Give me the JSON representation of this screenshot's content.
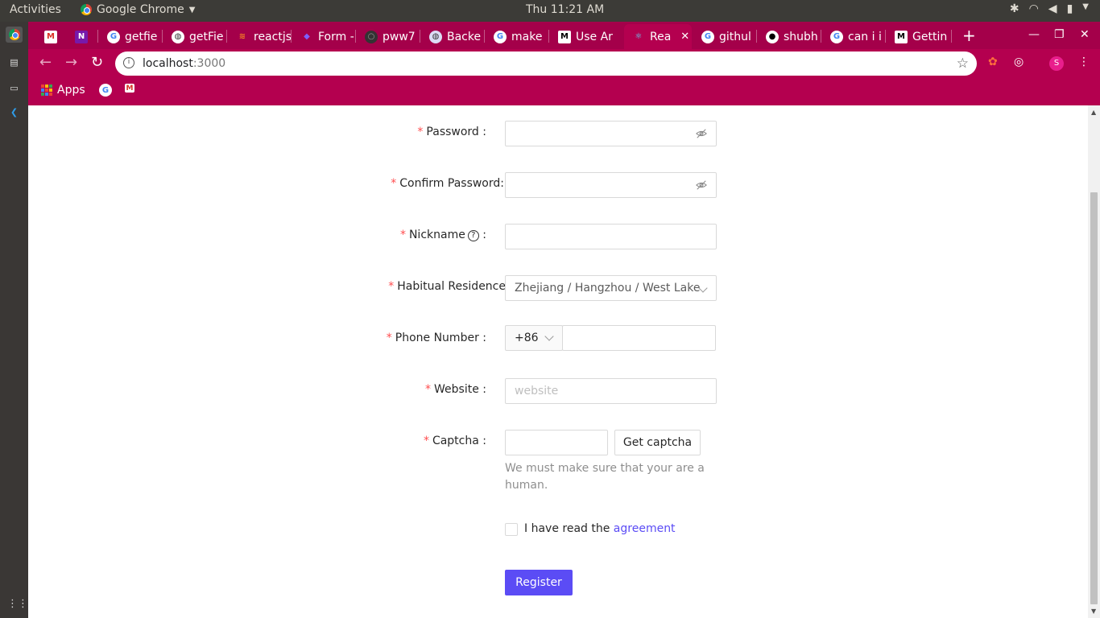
{
  "system_bar": {
    "activities": "Activities",
    "app_name": "Google Chrome",
    "clock": "Thu 11:21 AM"
  },
  "tabs": [
    {
      "title": "",
      "icon": "gmail-icon"
    },
    {
      "title": "",
      "icon": "onenote-icon"
    },
    {
      "title": "getfie",
      "icon": "google-icon"
    },
    {
      "title": "getFie",
      "icon": "globe-icon"
    },
    {
      "title": "reactjs",
      "icon": "stackoverflow-icon"
    },
    {
      "title": "Form -",
      "icon": "diamond-icon"
    },
    {
      "title": "pww7",
      "icon": "circle-icon"
    },
    {
      "title": "Backe",
      "icon": "globe-icon"
    },
    {
      "title": "make",
      "icon": "google-icon"
    },
    {
      "title": "Use Ar",
      "icon": "medium-icon"
    },
    {
      "title": "Rea",
      "icon": "react-icon",
      "active": true
    },
    {
      "title": "githul",
      "icon": "google-icon"
    },
    {
      "title": "shubh",
      "icon": "github-icon"
    },
    {
      "title": "can i i",
      "icon": "google-icon"
    },
    {
      "title": "Gettin",
      "icon": "medium-icon"
    }
  ],
  "address_bar": {
    "host": "localhost",
    "port": ":3000"
  },
  "bookmarks": {
    "apps_label": "Apps"
  },
  "profile_initial": "S",
  "form": {
    "password_label": "Password",
    "confirm_password_label": "Confirm Password",
    "nickname_label": "Nickname",
    "nickname_help": "?",
    "residence_label": "Habitual Residence",
    "residence_value": "Zhejiang / Hangzhou / West Lake",
    "phone_label": "Phone Number",
    "phone_prefix": "+86",
    "website_label": "Website",
    "website_placeholder": "website",
    "captcha_label": "Captcha",
    "captcha_button": "Get captcha",
    "captcha_extra": "We must make sure that your are a human.",
    "agreement_text": "I have read the",
    "agreement_link": "agreement",
    "register_button": "Register",
    "required_mark": "*",
    "colon": ":"
  },
  "colors": {
    "chrome_frame": "#a4004a",
    "chrome_toolbar": "#b4004f",
    "primary": "#5b4cf5",
    "required": "#ff4d4f"
  }
}
